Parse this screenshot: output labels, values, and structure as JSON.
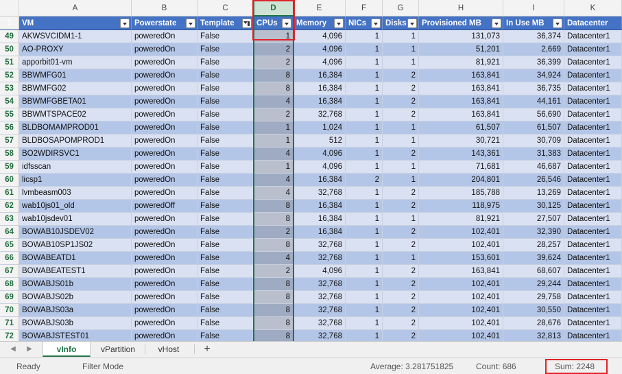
{
  "columns": [
    "A",
    "B",
    "C",
    "D",
    "E",
    "F",
    "G",
    "H",
    "I",
    "K"
  ],
  "header_row_number": "1",
  "headers": [
    "VM",
    "Powerstate",
    "Template",
    "CPUs",
    "Memory",
    "NICs",
    "Disks",
    "Provisioned MB",
    "In Use MB",
    "Datacenter"
  ],
  "rows": [
    {
      "n": "49",
      "vm": "AKWSVCIDM1-1",
      "ps": "poweredOn",
      "tpl": "False",
      "cpu": "1",
      "mem": "4,096",
      "nic": "1",
      "disk": "1",
      "prov": "131,073",
      "use": "36,374",
      "dc": "Datacenter1"
    },
    {
      "n": "50",
      "vm": "AO-PROXY",
      "ps": "poweredOn",
      "tpl": "False",
      "cpu": "2",
      "mem": "4,096",
      "nic": "1",
      "disk": "1",
      "prov": "51,201",
      "use": "2,669",
      "dc": "Datacenter1"
    },
    {
      "n": "51",
      "vm": "apporbit01-vm",
      "ps": "poweredOn",
      "tpl": "False",
      "cpu": "2",
      "mem": "4,096",
      "nic": "1",
      "disk": "1",
      "prov": "81,921",
      "use": "36,399",
      "dc": "Datacenter1"
    },
    {
      "n": "52",
      "vm": "BBWMFG01",
      "ps": "poweredOn",
      "tpl": "False",
      "cpu": "8",
      "mem": "16,384",
      "nic": "1",
      "disk": "2",
      "prov": "163,841",
      "use": "34,924",
      "dc": "Datacenter1"
    },
    {
      "n": "53",
      "vm": "BBWMFG02",
      "ps": "poweredOn",
      "tpl": "False",
      "cpu": "8",
      "mem": "16,384",
      "nic": "1",
      "disk": "2",
      "prov": "163,841",
      "use": "36,735",
      "dc": "Datacenter1"
    },
    {
      "n": "54",
      "vm": "BBWMFGBETA01",
      "ps": "poweredOn",
      "tpl": "False",
      "cpu": "4",
      "mem": "16,384",
      "nic": "1",
      "disk": "2",
      "prov": "163,841",
      "use": "44,161",
      "dc": "Datacenter1"
    },
    {
      "n": "55",
      "vm": "BBWMTSPACE02",
      "ps": "poweredOn",
      "tpl": "False",
      "cpu": "2",
      "mem": "32,768",
      "nic": "1",
      "disk": "2",
      "prov": "163,841",
      "use": "56,690",
      "dc": "Datacenter1"
    },
    {
      "n": "56",
      "vm": "BLDBOMAMPROD01",
      "ps": "poweredOn",
      "tpl": "False",
      "cpu": "1",
      "mem": "1,024",
      "nic": "1",
      "disk": "1",
      "prov": "61,507",
      "use": "61,507",
      "dc": "Datacenter1"
    },
    {
      "n": "57",
      "vm": "BLDBOSAPOMPROD1",
      "ps": "poweredOn",
      "tpl": "False",
      "cpu": "1",
      "mem": "512",
      "nic": "1",
      "disk": "1",
      "prov": "30,721",
      "use": "30,709",
      "dc": "Datacenter1"
    },
    {
      "n": "58",
      "vm": "BO2WDIRSVC1",
      "ps": "poweredOn",
      "tpl": "False",
      "cpu": "4",
      "mem": "4,096",
      "nic": "1",
      "disk": "2",
      "prov": "143,361",
      "use": "31,383",
      "dc": "Datacenter1"
    },
    {
      "n": "59",
      "vm": "idfsscan",
      "ps": "poweredOn",
      "tpl": "False",
      "cpu": "1",
      "mem": "4,096",
      "nic": "1",
      "disk": "1",
      "prov": "71,681",
      "use": "46,687",
      "dc": "Datacenter1"
    },
    {
      "n": "60",
      "vm": "licsp1",
      "ps": "poweredOn",
      "tpl": "False",
      "cpu": "4",
      "mem": "16,384",
      "nic": "2",
      "disk": "1",
      "prov": "204,801",
      "use": "26,546",
      "dc": "Datacenter1"
    },
    {
      "n": "61",
      "vm": "lvmbeasm003",
      "ps": "poweredOn",
      "tpl": "False",
      "cpu": "4",
      "mem": "32,768",
      "nic": "1",
      "disk": "2",
      "prov": "185,788",
      "use": "13,269",
      "dc": "Datacenter1"
    },
    {
      "n": "62",
      "vm": "wab10js01_old",
      "ps": "poweredOff",
      "tpl": "False",
      "cpu": "8",
      "mem": "16,384",
      "nic": "1",
      "disk": "2",
      "prov": "118,975",
      "use": "30,125",
      "dc": "Datacenter1"
    },
    {
      "n": "63",
      "vm": "wab10jsdev01",
      "ps": "poweredOn",
      "tpl": "False",
      "cpu": "8",
      "mem": "16,384",
      "nic": "1",
      "disk": "1",
      "prov": "81,921",
      "use": "27,507",
      "dc": "Datacenter1"
    },
    {
      "n": "64",
      "vm": "BOWAB10JSDEV02",
      "ps": "poweredOn",
      "tpl": "False",
      "cpu": "2",
      "mem": "16,384",
      "nic": "1",
      "disk": "2",
      "prov": "102,401",
      "use": "32,390",
      "dc": "Datacenter1"
    },
    {
      "n": "65",
      "vm": "BOWAB10SP1JS02",
      "ps": "poweredOn",
      "tpl": "False",
      "cpu": "8",
      "mem": "32,768",
      "nic": "1",
      "disk": "2",
      "prov": "102,401",
      "use": "28,257",
      "dc": "Datacenter1"
    },
    {
      "n": "66",
      "vm": "BOWABEATD1",
      "ps": "poweredOn",
      "tpl": "False",
      "cpu": "4",
      "mem": "32,768",
      "nic": "1",
      "disk": "1",
      "prov": "153,601",
      "use": "39,624",
      "dc": "Datacenter1"
    },
    {
      "n": "67",
      "vm": "BOWABEATEST1",
      "ps": "poweredOn",
      "tpl": "False",
      "cpu": "2",
      "mem": "4,096",
      "nic": "1",
      "disk": "2",
      "prov": "163,841",
      "use": "68,607",
      "dc": "Datacenter1"
    },
    {
      "n": "68",
      "vm": "BOWABJS01b",
      "ps": "poweredOn",
      "tpl": "False",
      "cpu": "8",
      "mem": "32,768",
      "nic": "1",
      "disk": "2",
      "prov": "102,401",
      "use": "29,244",
      "dc": "Datacenter1"
    },
    {
      "n": "69",
      "vm": "BOWABJS02b",
      "ps": "poweredOn",
      "tpl": "False",
      "cpu": "8",
      "mem": "32,768",
      "nic": "1",
      "disk": "2",
      "prov": "102,401",
      "use": "29,758",
      "dc": "Datacenter1"
    },
    {
      "n": "70",
      "vm": "BOWABJS03a",
      "ps": "poweredOn",
      "tpl": "False",
      "cpu": "8",
      "mem": "32,768",
      "nic": "1",
      "disk": "2",
      "prov": "102,401",
      "use": "30,550",
      "dc": "Datacenter1"
    },
    {
      "n": "71",
      "vm": "BOWABJS03b",
      "ps": "poweredOn",
      "tpl": "False",
      "cpu": "8",
      "mem": "32,768",
      "nic": "1",
      "disk": "2",
      "prov": "102,401",
      "use": "28,676",
      "dc": "Datacenter1"
    },
    {
      "n": "72",
      "vm": "BOWABJSTEST01",
      "ps": "poweredOn",
      "tpl": "False",
      "cpu": "8",
      "mem": "32,768",
      "nic": "1",
      "disk": "2",
      "prov": "102,401",
      "use": "32,813",
      "dc": "Datacenter1"
    }
  ],
  "sheet_tabs": {
    "active": "vInfo",
    "second": "vPartition",
    "third": "vHost",
    "add": "+"
  },
  "status": {
    "ready": "Ready",
    "mode": "Filter Mode",
    "average": "Average: 3.281751825",
    "count": "Count: 686",
    "sum": "Sum: 2248"
  },
  "colors": {
    "accent": "#217346",
    "header": "#4472c4",
    "band_light": "#d9e1f2",
    "band_dark": "#b4c6e7",
    "highlight": "#e0242a"
  }
}
